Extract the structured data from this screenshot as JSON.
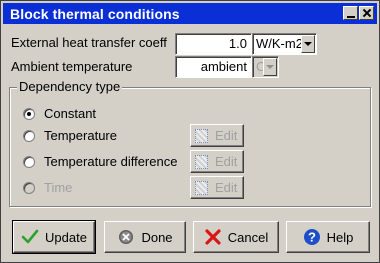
{
  "window": {
    "title": "Block thermal conditions"
  },
  "fields": {
    "htc_label": "External heat transfer coeff",
    "htc_value": "1.0",
    "htc_unit": "W/K-m2",
    "ambient_label": "Ambient temperature",
    "ambient_value": "ambient",
    "ambient_unit": "C"
  },
  "dependency": {
    "legend": "Dependency type",
    "options": [
      {
        "label": "Constant",
        "checked": true,
        "enabled": true
      },
      {
        "label": "Temperature",
        "checked": false,
        "enabled": true
      },
      {
        "label": "Temperature difference",
        "checked": false,
        "enabled": true
      },
      {
        "label": "Time",
        "checked": false,
        "enabled": false
      }
    ],
    "edit_label": "Edit"
  },
  "buttons": {
    "update": "Update",
    "done": "Done",
    "cancel": "Cancel",
    "help": "Help"
  },
  "icons": {
    "update": "checkmark-icon",
    "done": "done-icon",
    "cancel": "x-icon",
    "help": "question-icon"
  },
  "colors": {
    "titlebar": "#0a2fd6",
    "dialog": "#d4d0c8",
    "check_green": "#2ea02e",
    "cancel_red": "#d81818",
    "help_blue": "#1f4fc8"
  }
}
